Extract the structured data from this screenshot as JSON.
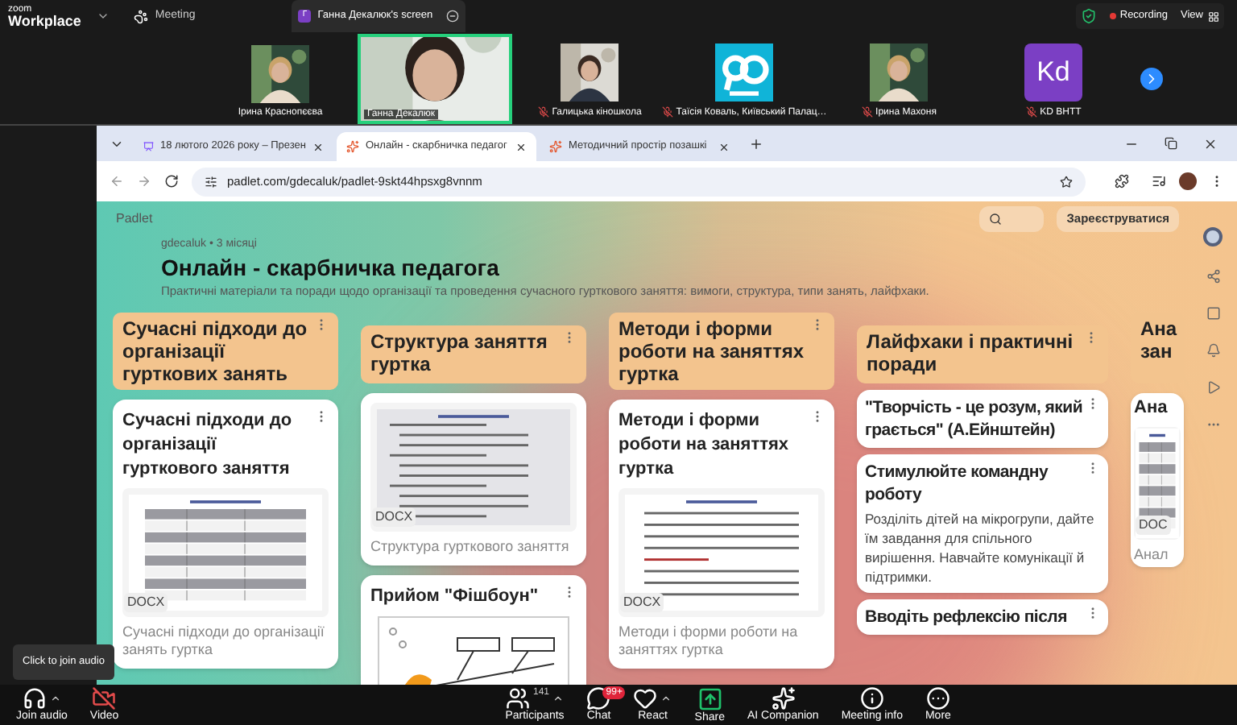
{
  "zoom": {
    "logo_top": "zoom",
    "logo_bottom": "Workplace",
    "meeting_tab": "Meeting",
    "share_tab": {
      "initial": "Г",
      "title": "Ганна Декалюк's screen"
    },
    "recording": "Recording",
    "view": "View"
  },
  "participants": [
    {
      "name": "Ірина Краснопєєва",
      "kind": "video",
      "muted": false,
      "speaking": false
    },
    {
      "name": "Ганна Декалюк",
      "kind": "video",
      "muted": false,
      "speaking": true
    },
    {
      "name": "Галицька кіношкола",
      "kind": "video",
      "muted": true,
      "speaking": false
    },
    {
      "name": "Таїсія Коваль, Київський Палац…",
      "kind": "logo",
      "muted": true,
      "speaking": false
    },
    {
      "name": "Ірина Махоня",
      "kind": "video",
      "muted": true,
      "speaking": false
    },
    {
      "name": "KD ВНТТ",
      "kind": "initials",
      "initials": "Kd",
      "muted": true,
      "speaking": false
    }
  ],
  "browser": {
    "tabs": [
      {
        "title": "18 лютого 2026 року – Презен",
        "selected": false,
        "kind": "slides"
      },
      {
        "title": "Онлайн - скарбничка педагог",
        "selected": true,
        "kind": "padlet"
      },
      {
        "title": "Методичний простір позашкі",
        "selected": false,
        "kind": "padlet"
      }
    ],
    "url": "padlet.com/gdecaluk/padlet-9skt44hpsxg8vnnm"
  },
  "padlet": {
    "brand": "Padlet",
    "meta": "gdecaluk • 3 місяці",
    "title": "Онлайн - скарбничка педагога",
    "description": "Практичні матеріали та поради щодо організації та проведення сучасного гурткового заняття: вимоги, структура, типи занять, лайфхаки.",
    "signup": "Зареєструватися",
    "columns": [
      {
        "title": "Сучасні підходи до організації гурткових занять",
        "posts": [
          {
            "kind": "doc",
            "title": "Сучасні підходи до організації гурткового заняття",
            "badge": "DOCX",
            "caption": "Сучасні підходи до організації занять гуртка"
          }
        ]
      },
      {
        "title": "Структура заняття гуртка",
        "posts": [
          {
            "kind": "doc",
            "badge": "DOCX",
            "caption": "Структура гурткового заняття"
          },
          {
            "kind": "fishbone",
            "title": "Прийом \"Фішбоун\""
          }
        ]
      },
      {
        "title": "Методи і форми роботи на заняттях гуртка",
        "posts": [
          {
            "kind": "doc",
            "title": "Методи і форми роботи на заняттях гуртка",
            "badge": "DOCX",
            "caption": "Методи  і форми роботи на заняттях гуртка"
          }
        ]
      },
      {
        "title": "Лайфхаки і практичні поради",
        "posts": [
          {
            "kind": "text",
            "title": "\"Творчість - це розум, який грається\" (А.Ейнштейн)"
          },
          {
            "kind": "text",
            "title": "Стимулюйте командну роботу",
            "body": "Розділіть дітей на мікрогрупи, дайте їм завдання для спільного вирішення. Навчайте комунікації й підтримки."
          },
          {
            "kind": "text",
            "title": "Вводіть рефлексію після"
          }
        ]
      },
      {
        "title": "Ана зан",
        "posts": [
          {
            "kind": "doc",
            "title": "Ана",
            "badge": "DOC",
            "caption": "Анал"
          }
        ]
      }
    ]
  },
  "tooltip": "Click to join audio",
  "toolbar": [
    {
      "kind": "audio",
      "label": "Join audio",
      "caret": true
    },
    {
      "kind": "video",
      "label": "Video",
      "caret": false
    },
    {
      "kind": "participants",
      "label": "Participants",
      "count": "141",
      "caret": true
    },
    {
      "kind": "chat",
      "label": "Chat",
      "badge": "99+",
      "caret": false
    },
    {
      "kind": "react",
      "label": "React",
      "caret": true
    },
    {
      "kind": "share",
      "label": "Share",
      "caret": false
    },
    {
      "kind": "ai",
      "label": "AI Companion",
      "caret": false
    },
    {
      "kind": "info",
      "label": "Meeting info",
      "caret": false
    },
    {
      "kind": "more",
      "label": "More",
      "caret": false
    }
  ]
}
